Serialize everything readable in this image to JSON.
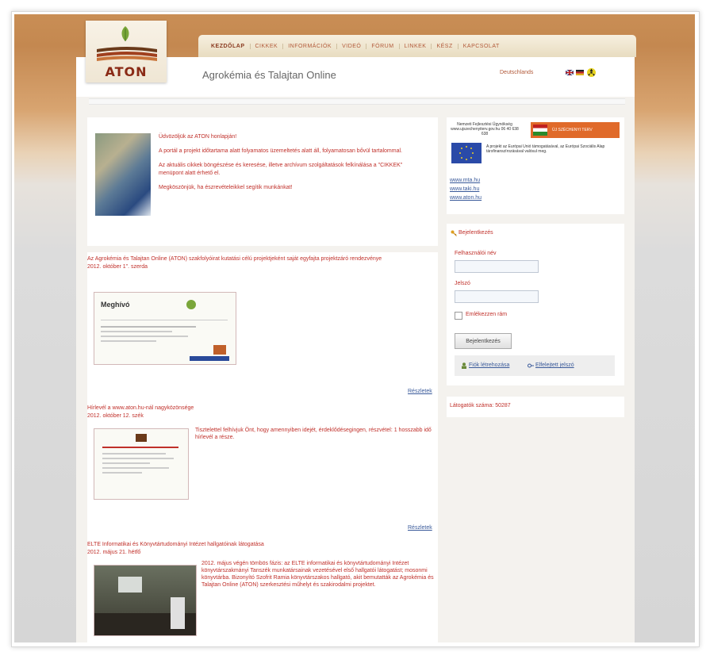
{
  "site": {
    "logo_text": "ATON",
    "title": "Agrokémia és Talajtan Online",
    "language_link": "Deutschlands"
  },
  "nav": [
    "KEZDŐLAP",
    "CIKKEK",
    "INFORMÁCIÓK",
    "VIDEÓ",
    "FÓRUM",
    "LINKEK",
    "KÉSZ",
    "KAPCSOLAT"
  ],
  "intro": {
    "paragraphs": [
      "Üdvözöljük az ATON honlapján!",
      "A portál a projekt időtartama alatt folyamatos üzemeltetés alatt áll, folyamatosan bővül tartalommal.",
      "Az aktuális cikkek böngészése és keresése, illetve archívum szolgáltatások felkínálása a \"CIKKEK\" menüpont alatt érhető el.",
      "Megköszönjük, ha észrevételeikkel segítik munkánkat!"
    ]
  },
  "news": [
    {
      "title": "Az Agrokémia és Talajtan Online (ATON) szakfolyóirat kutatási célú projektjeként saját egyfajta projektzáró rendezvénye",
      "date": "2012. október 1\". szerda",
      "more": "Részletek"
    },
    {
      "title": "Hírlevél a www.aton.hu-nál nagyközönsége",
      "date": "2012. október 12. szék",
      "body": "Tisztelettel felhívjuk Önt, hogy amennyiben idejét, érdeklődésegingen, részvétel: 1 hosszabb idő hírlevél a része.",
      "more": "Részletek"
    },
    {
      "title": "ELTE Informatikai és Könyvtártudományi Intézet hallgatóinak látogatása",
      "date": "2012. május 21. hétfő",
      "body": "2012. május végén tömbös fázis: az ELTE informatikai és könyvtártudományi Intézet könyvtárszakmányi Tanszék munkatársainak vezetésével első hallgatói látogatást; mosonmi könyvtárba. Bizonyító Szofrit Ramia könyvtárszakos hallgató, akit bemutatták az Agrokémia és Talajtan Online (ATON) szerkesztési műhelyt és szakirodalmi projektet.",
      "more": ""
    }
  ],
  "sidebar": {
    "sponsor_caption": "Nemzeti Fejlesztési Ügynökség www.ujszechenyiterv.gov.hu 06 40 638 638",
    "sponsor_badge": "ÚJ SZÉCHENYI TERV",
    "eu_text": "A projekt az Európai Unió támogatásával, az Európai Szociális Alap társfinanszírozásával valósul meg.",
    "links": [
      "www.mta.hu",
      "www.taki.hu",
      "www.aton.hu"
    ],
    "login": {
      "heading": "Bejelentkezés",
      "username_label": "Felhasználói név",
      "password_label": "Jelszó",
      "remember_label": "Emlékezzen rám",
      "submit": "Bejelentkezés",
      "register": "Fiók létrehozása",
      "forgot": "Elfelejtett jelszó"
    },
    "visitors": "Látogatók száma: 50287"
  }
}
